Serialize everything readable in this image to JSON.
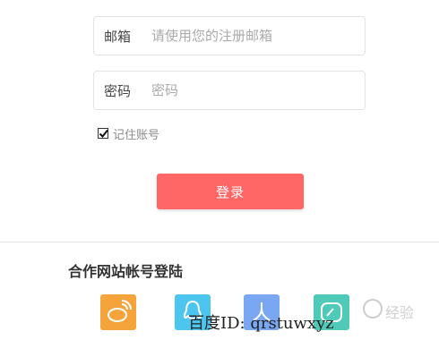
{
  "login_form": {
    "email": {
      "label": "邮箱",
      "placeholder": "请使用您的注册邮箱",
      "value": ""
    },
    "password": {
      "label": "密码",
      "placeholder": "密码",
      "value": ""
    },
    "remember": {
      "label": "记住账号",
      "checked": true
    },
    "submit_label": "登录"
  },
  "partner_login": {
    "title": "合作网站帐号登陆",
    "providers": [
      {
        "icon": "weibo-icon",
        "color": "#f5a43b"
      },
      {
        "icon": "qq-icon",
        "color": "#4cc5ef"
      },
      {
        "icon": "renren-icon",
        "color": "#7aa7f2"
      },
      {
        "icon": "douban-icon",
        "color": "#4fc9b8"
      }
    ]
  },
  "watermark": {
    "text": "百度ID: qrstuwxyz",
    "logo_text": "经验"
  },
  "colors": {
    "accent": "#ff6767",
    "border": "#e3e3e3"
  }
}
